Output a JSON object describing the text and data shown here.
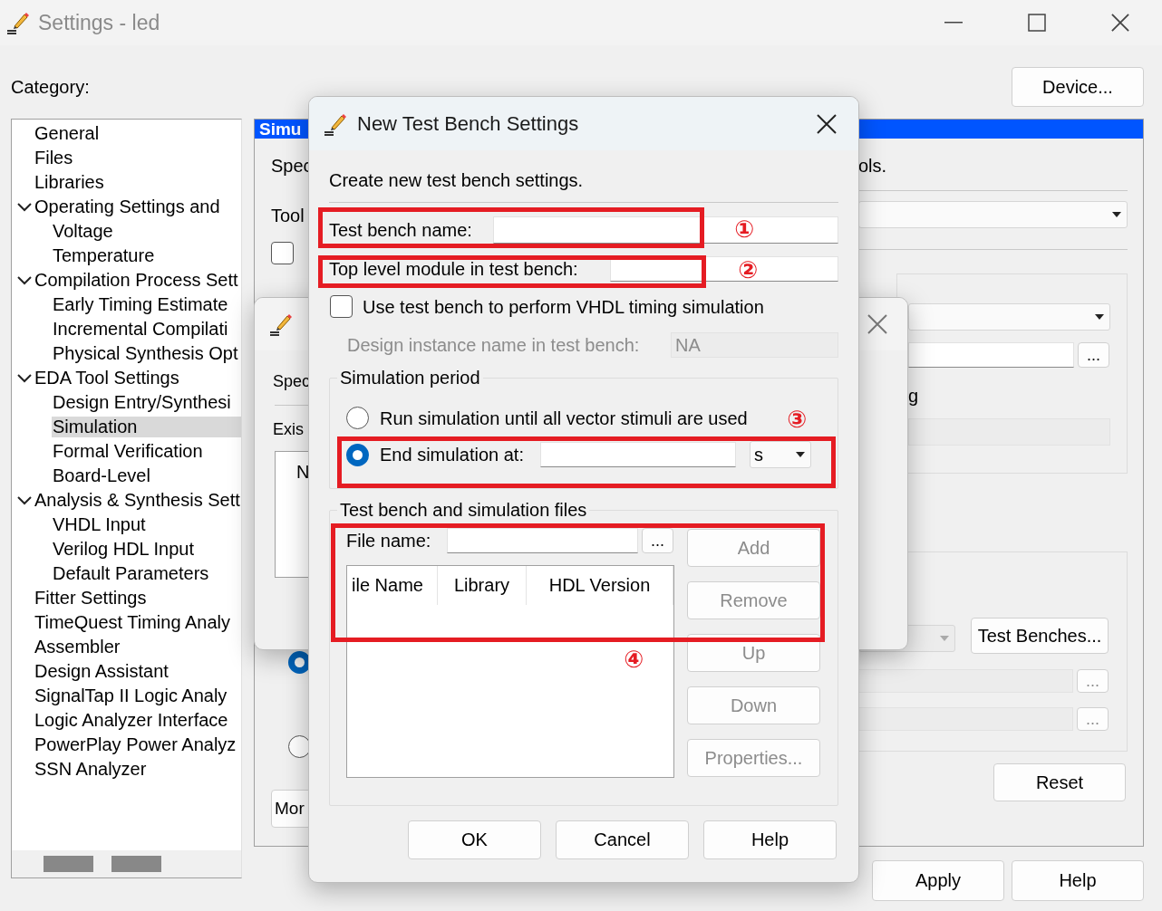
{
  "window": {
    "title": "Settings - led"
  },
  "category_label": "Category:",
  "device_button": "Device...",
  "category_tree": [
    {
      "label": "General",
      "selected": false
    },
    {
      "label": "Files",
      "selected": false
    },
    {
      "label": "Libraries",
      "selected": false
    },
    {
      "label": "Operating Settings and",
      "selected": false,
      "expanded": true,
      "children": [
        {
          "label": "Voltage",
          "selected": false
        },
        {
          "label": "Temperature",
          "selected": false
        }
      ]
    },
    {
      "label": "Compilation Process Sett",
      "selected": false,
      "expanded": true,
      "children": [
        {
          "label": "Early Timing Estimate",
          "selected": false
        },
        {
          "label": "Incremental Compilati",
          "selected": false
        },
        {
          "label": "Physical Synthesis Opt",
          "selected": false
        }
      ]
    },
    {
      "label": "EDA Tool Settings",
      "selected": false,
      "expanded": true,
      "children": [
        {
          "label": "Design Entry/Synthesi",
          "selected": false
        },
        {
          "label": "Simulation",
          "selected": true
        },
        {
          "label": "Formal Verification",
          "selected": false
        },
        {
          "label": "Board-Level",
          "selected": false
        }
      ]
    },
    {
      "label": "Analysis & Synthesis Sett",
      "selected": false,
      "expanded": true,
      "children": [
        {
          "label": "VHDL Input",
          "selected": false
        },
        {
          "label": "Verilog HDL Input",
          "selected": false
        },
        {
          "label": "Default Parameters",
          "selected": false
        }
      ]
    },
    {
      "label": "Fitter Settings",
      "selected": false
    },
    {
      "label": "TimeQuest Timing Analy",
      "selected": false
    },
    {
      "label": "Assembler",
      "selected": false
    },
    {
      "label": "Design Assistant",
      "selected": false
    },
    {
      "label": "SignalTap II Logic Analy",
      "selected": false
    },
    {
      "label": "Logic Analyzer Interface",
      "selected": false
    },
    {
      "label": "PowerPlay Power Analyz",
      "selected": false
    },
    {
      "label": "SSN Analyzer",
      "selected": false
    }
  ],
  "panel": {
    "header": "Simu",
    "description_start": "Spec",
    "description_end": "ols.",
    "tool_label": "Tool",
    "tool_checkbox": {
      "checked": false
    },
    "side_text": "g",
    "radios": [
      {
        "selected": true
      },
      {
        "selected": false
      }
    ],
    "more_button": "Mor",
    "test_benches_button": "Test Benches...",
    "browse_buttons": [
      "...",
      "...",
      "..."
    ],
    "reset_button": "Reset"
  },
  "background_dialog": {
    "label_1": "Spec",
    "label_2": "Exis",
    "list_item": "N"
  },
  "footer_buttons": [
    "Apply",
    "Help"
  ],
  "dialog": {
    "title": "New Test Bench Settings",
    "description": "Create new test bench settings.",
    "name_label": "Test bench name:",
    "top_level_label": "Top level module in test bench:",
    "vhdl_timing": {
      "label": "Use test bench to perform VHDL timing simulation",
      "checked": false
    },
    "instance": {
      "label": "Design instance name in test bench:",
      "value": "NA",
      "disabled": true
    },
    "simulation_period": {
      "title": "Simulation period",
      "options": [
        {
          "label": "Run simulation until all vector stimuli are used",
          "selected": false
        },
        {
          "label": "End simulation at:",
          "selected": true
        }
      ],
      "unit": "s"
    },
    "files": {
      "title": "Test bench and simulation files",
      "file_name_label": "File name:",
      "browse": "...",
      "columns": [
        "ile Name",
        "Library",
        "HDL Version"
      ],
      "buttons": [
        {
          "label": "Add",
          "disabled": true
        },
        {
          "label": "Remove",
          "disabled": true
        },
        {
          "label": "Up",
          "disabled": true
        },
        {
          "label": "Down",
          "disabled": true
        },
        {
          "label": "Properties...",
          "disabled": true
        }
      ]
    },
    "buttons": [
      "OK",
      "Cancel",
      "Help"
    ]
  },
  "annotations": [
    {
      "number": "①"
    },
    {
      "number": "②"
    },
    {
      "number": "③"
    },
    {
      "number": "④"
    }
  ]
}
